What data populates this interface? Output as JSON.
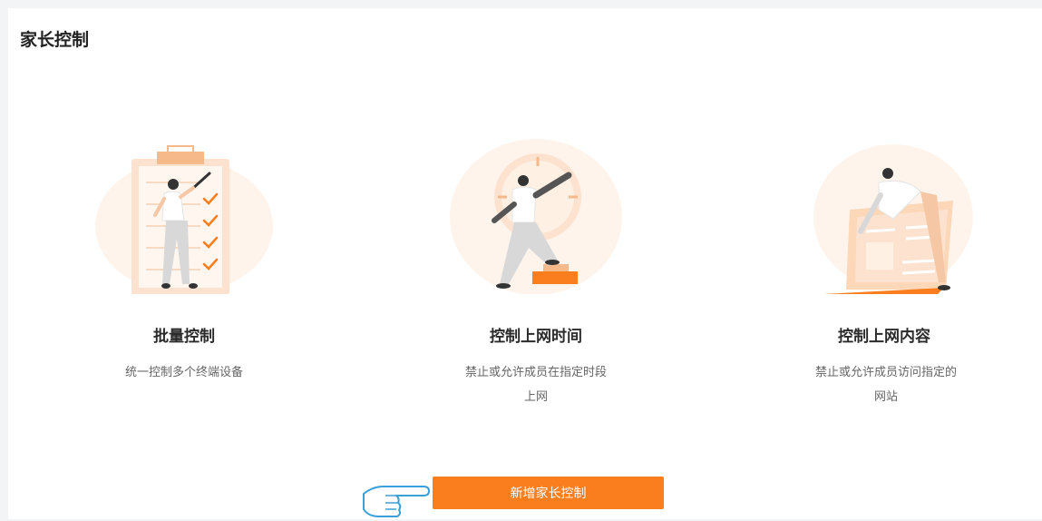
{
  "page": {
    "title": "家长控制"
  },
  "features": [
    {
      "title": "批量控制",
      "desc_lines": [
        "统一控制多个终端设备"
      ]
    },
    {
      "title": "控制上网时间",
      "desc_lines": [
        "禁止或允许成员在指定时段",
        "上网"
      ]
    },
    {
      "title": "控制上网内容",
      "desc_lines": [
        "禁止或允许成员访问指定的",
        "网站"
      ]
    }
  ],
  "actions": {
    "add_label": "新增家长控制"
  },
  "icons": {
    "feature1": "clipboard-checklist-icon",
    "feature2": "clock-time-icon",
    "feature3": "laptop-content-icon",
    "pointer": "pointing-hand-icon"
  },
  "colors": {
    "accent": "#fa7d1e",
    "accent_light": "#fde3cf",
    "accent_pale": "#fef4ec"
  }
}
